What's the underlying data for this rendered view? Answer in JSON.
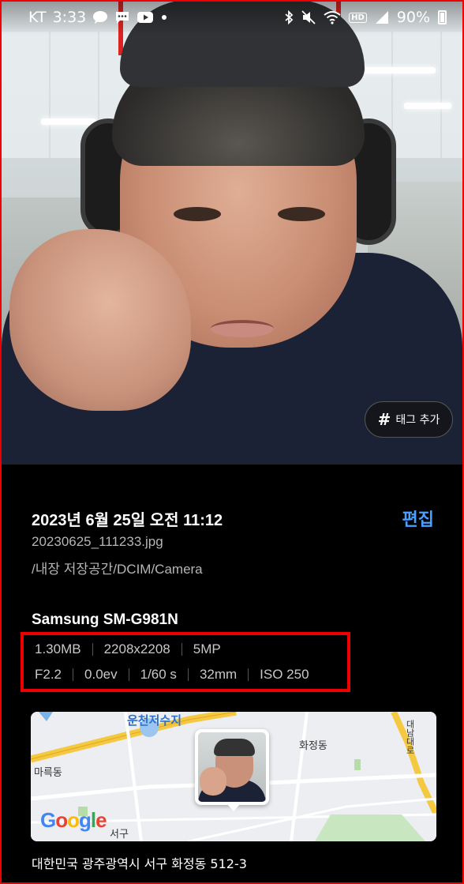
{
  "status_bar": {
    "carrier": "KT",
    "time": "3:33",
    "battery": "90%",
    "icons_left": [
      "chat-bubble-icon",
      "message-icon",
      "youtube-icon",
      "dot-icon"
    ],
    "icons_right": [
      "bluetooth-icon",
      "mute-icon",
      "wifi-icon",
      "hd-icon",
      "signal-icon",
      "battery-icon"
    ]
  },
  "photo": {
    "tag_button": {
      "icon": "#",
      "label": "태그 추가"
    }
  },
  "details": {
    "datetime": "2023년 6월 25일 오전 11:12",
    "edit_label": "편집",
    "filename": "20230625_111233.jpg",
    "path": "/내장 저장공간/DCIM/Camera",
    "device": "Samsung SM-G981N",
    "specs_row1": [
      "1.30MB",
      "2208x2208",
      "5MP"
    ],
    "specs_row2": [
      "F2.2",
      "0.0ev",
      "1/60 s",
      "32mm",
      "ISO 250"
    ]
  },
  "map": {
    "labels": {
      "reservoir": "운천저수지",
      "hwajeong": "화정동",
      "marukdong": "마륵동",
      "seogu": "서구",
      "daenamdaero": "대남대로"
    },
    "logo": "Google"
  },
  "address": "대한민국 광주광역시 서구 화정동 512-3",
  "colors": {
    "accent": "#4a9fff",
    "highlight_box": "#ee0000",
    "background": "#000000"
  }
}
